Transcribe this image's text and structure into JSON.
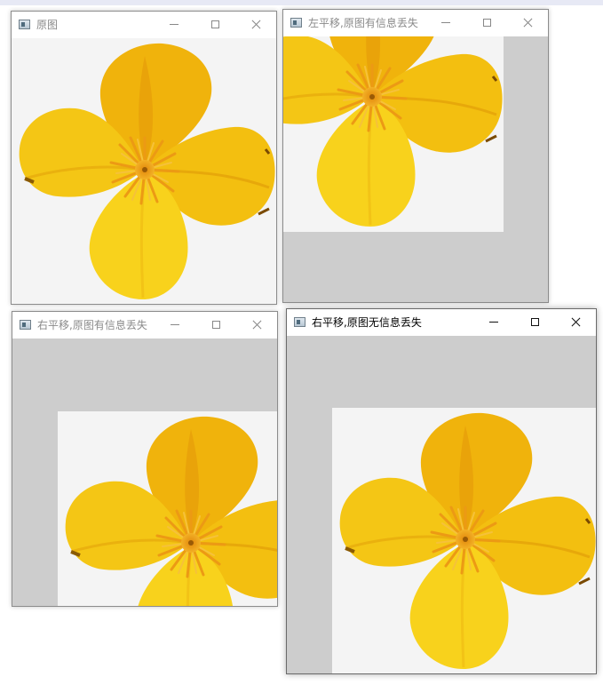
{
  "desktop": {
    "background": "#ffffff"
  },
  "windows": [
    {
      "title": "原图",
      "active": false
    },
    {
      "title": "左平移,原图有信息丢失",
      "active": false
    },
    {
      "title": "右平移,原图有信息丢失",
      "active": false
    },
    {
      "title": "右平移,原图无信息丢失",
      "active": true
    }
  ],
  "controls": {
    "minimize": "minimize-icon",
    "maximize": "maximize-icon",
    "close": "close-icon"
  },
  "colors": {
    "image_background": "#f4f4f4",
    "canvas_fill": "#cdcdcd",
    "petal_yellow": "#f6c90c",
    "petal_orange": "#e79b08",
    "stamen_orange": "#f0a21a"
  }
}
